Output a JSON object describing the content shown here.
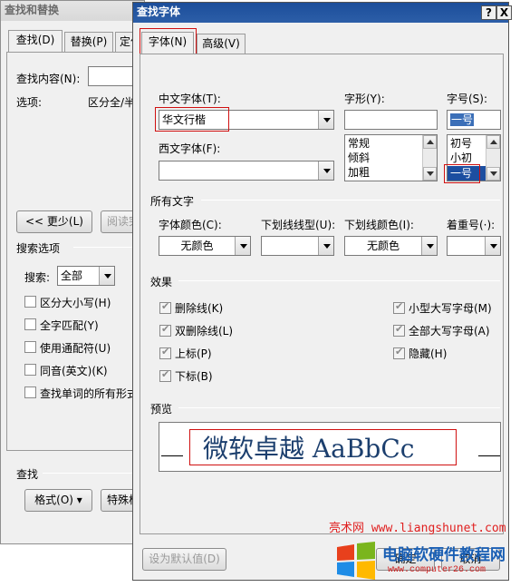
{
  "back": {
    "title": "查找和替换",
    "tabs": [
      "查找(D)",
      "替换(P)",
      "定位"
    ],
    "find_label": "查找内容(N):",
    "options_label": "选项:",
    "options_value": "区分全/半",
    "less_button": "<< 更少(L)",
    "reading_button": "阅读突",
    "search_options": "搜索选项",
    "search_label": "搜索:",
    "search_value": "全部",
    "checks": [
      "区分大小写(H)",
      "全字匹配(Y)",
      "使用通配符(U)",
      "同音(英文)(K)",
      "查找单词的所有形式"
    ],
    "find_section": "查找",
    "format_button": "格式(O) ▾",
    "special_button": "特殊格"
  },
  "dialog": {
    "title": "查找字体",
    "help_btn": "?",
    "close_btn": "X",
    "tabs": [
      "字体(N)",
      "高级(V)"
    ],
    "chinese_font_label": "中文字体(T):",
    "chinese_font_value": "华文行楷",
    "western_font_label": "西文字体(F):",
    "western_font_value": "",
    "style_label": "字形(Y):",
    "style_value": "",
    "style_items": [
      "常规",
      "倾斜",
      "加粗"
    ],
    "size_label": "字号(S):",
    "size_value": "一号",
    "size_items": [
      "初号",
      "小初",
      "一号"
    ],
    "all_text": "所有文字",
    "font_color_label": "字体颜色(C):",
    "font_color_value": "无颜色",
    "underline_label": "下划线线型(U):",
    "underline_value": "",
    "underline_color_label": "下划线颜色(I):",
    "underline_color_value": "无颜色",
    "emphasis_label": "着重号(·):",
    "emphasis_value": "",
    "effects": "效果",
    "effects_left": [
      "删除线(K)",
      "双删除线(L)",
      "上标(P)",
      "下标(B)"
    ],
    "effects_right": [
      "小型大写字母(M)",
      "全部大写字母(A)",
      "隐藏(H)"
    ],
    "preview_label": "预览",
    "preview_text": "微软卓越 AaBbCc",
    "default_button": "设为默认值(D)",
    "ok_button": "确定",
    "cancel_button": "取消"
  },
  "watermark": {
    "text": "亮术网 www.liangshunet.com",
    "brand": "电脑软硬件教程网",
    "brand_url": "www.computer26.com"
  }
}
